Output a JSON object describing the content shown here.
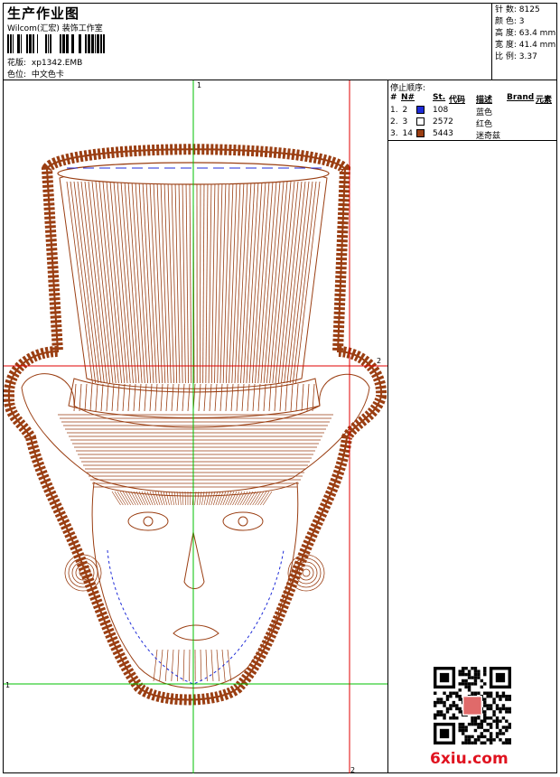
{
  "header": {
    "title": "生产作业图",
    "company": "Wilcom(汇宏) 装饰工作室",
    "design_label": "花版:",
    "design_value": "xp1342.EMB",
    "colorway_label": "色位:",
    "colorway_value": "中文色卡"
  },
  "stats": {
    "stitches_label": "针 数:",
    "stitches_value": "8125",
    "colors_label": "颜 色:",
    "colors_value": "3",
    "height_label": "高 度:",
    "height_value": "63.4 mm",
    "width_label": "宽 度:",
    "width_value": "41.4 mm",
    "ratio_label": "比 例:",
    "ratio_value": "3.37"
  },
  "stop_sequence": {
    "title": "停止顺序:",
    "headers": {
      "num": "#",
      "needle": "N#",
      "st": "St.",
      "code": "代码",
      "desc": "描述",
      "brand": "Brand",
      "element": "元素"
    },
    "rows": [
      {
        "num": "1.",
        "needle": "2",
        "color": "#1e2bd8",
        "code": "108",
        "desc": "蓝色"
      },
      {
        "num": "2.",
        "needle": "3",
        "color": "#ffffff",
        "code": "2572",
        "desc": "红色"
      },
      {
        "num": "3.",
        "needle": "14",
        "color": "#9a3e12",
        "code": "5443",
        "desc": "迷奇兹"
      }
    ]
  },
  "guides": {
    "green_vertical_label": "1",
    "green_horizontal_label": "1",
    "red_horizontal_label": "2",
    "red_vertical_label": "2",
    "green_color": "#00c000",
    "red_color": "#e00000"
  },
  "design": {
    "stitch_color": "#9a3e12",
    "accent_color": "#1e2bd8"
  },
  "watermark": {
    "site": "6xiu.com"
  }
}
